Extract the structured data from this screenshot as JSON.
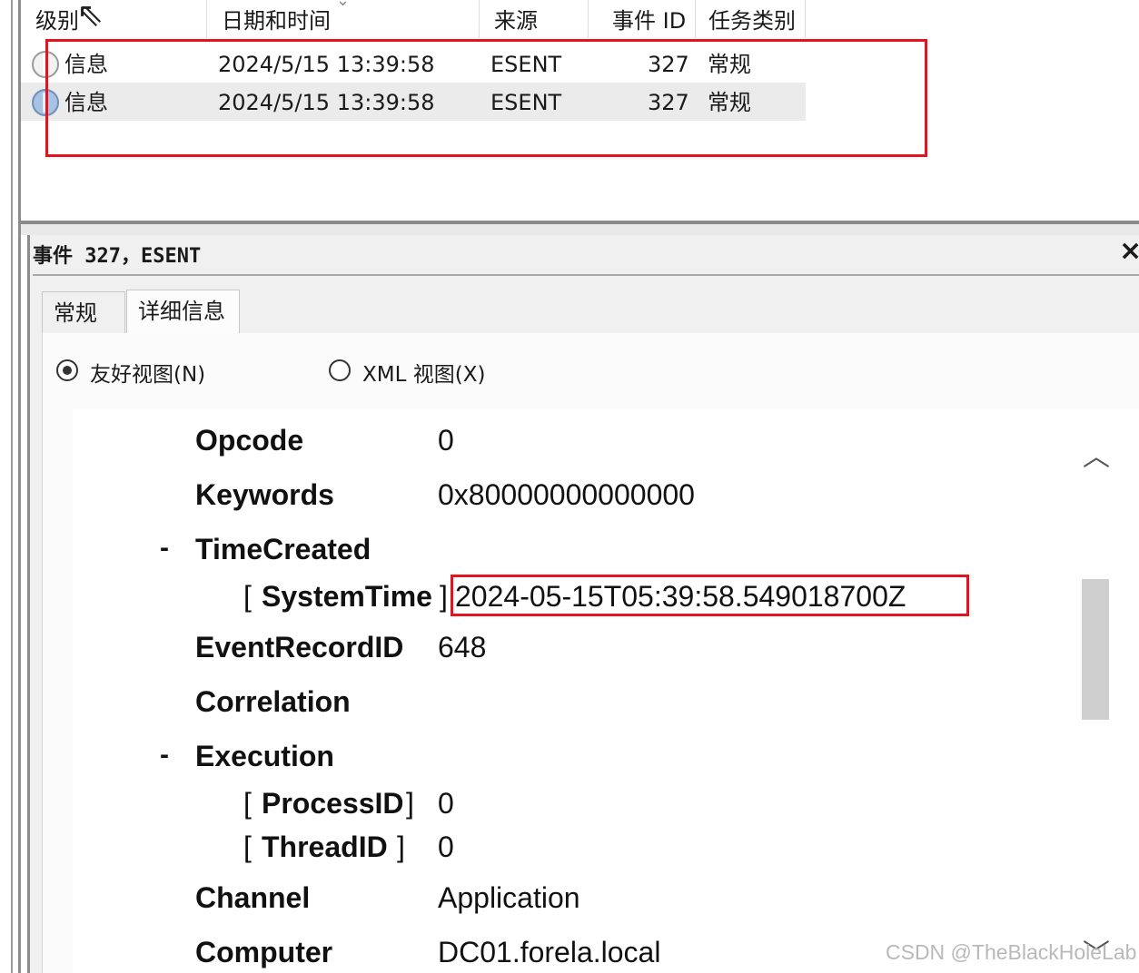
{
  "event_list": {
    "columns": [
      {
        "label": "级别"
      },
      {
        "label": "日期和时间"
      },
      {
        "label": "来源"
      },
      {
        "label": "事件 ID"
      },
      {
        "label": "任务类别"
      }
    ],
    "rows": [
      {
        "level": "信息",
        "datetime": "2024/5/15 13:39:58",
        "source": "ESENT",
        "event_id": "327",
        "category": "常规"
      },
      {
        "level": "信息",
        "datetime": "2024/5/15 13:39:58",
        "source": "ESENT",
        "event_id": "327",
        "category": "常规"
      }
    ]
  },
  "details": {
    "title": "事件 327，ESENT",
    "close_glyph": "×",
    "tabs": [
      {
        "label": "常规"
      },
      {
        "label": "详细信息"
      }
    ],
    "view_options": {
      "friendly": "友好视图(N)",
      "xml": "XML 视图(X)"
    },
    "fields": {
      "opcode": {
        "label": "Opcode",
        "value": "0"
      },
      "keywords": {
        "label": "Keywords",
        "value": "0x80000000000000"
      },
      "time_created": {
        "label": "TimeCreated"
      },
      "system_time": {
        "label": "SystemTime",
        "value": "2024-05-15T05:39:58.549018700Z"
      },
      "event_record_id": {
        "label": "EventRecordID",
        "value": "648"
      },
      "correlation": {
        "label": "Correlation"
      },
      "execution": {
        "label": "Execution"
      },
      "process_id": {
        "label": "ProcessID",
        "value": "0"
      },
      "thread_id": {
        "label": "ThreadID",
        "value": "0"
      },
      "channel": {
        "label": "Channel",
        "value": "Application"
      },
      "computer": {
        "label": "Computer",
        "value": "DC01.forela.local"
      }
    }
  },
  "watermark": "CSDN @TheBlackHoleLab",
  "colors": {
    "highlight_red": "#e5131f",
    "info_icon_blue": "#a7c3e4",
    "selected_row": "#ebebeb"
  },
  "icons": {
    "info": "info-circle-icon",
    "scroll_up": "chevron-up-icon",
    "scroll_down": "chevron-down-icon",
    "cursor": "mouse-pointer-icon"
  }
}
